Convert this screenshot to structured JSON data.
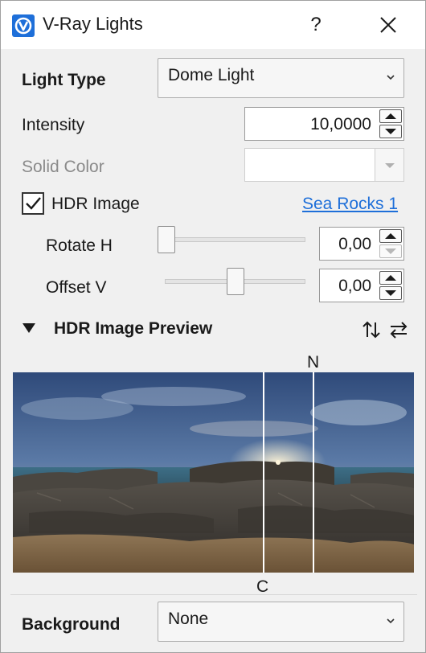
{
  "window": {
    "title": "V-Ray Lights",
    "help_label": "?",
    "close_icon": "close-icon",
    "app_icon": "vray-logo-icon"
  },
  "light_type": {
    "label": "Light Type",
    "value": "Dome Light"
  },
  "intensity": {
    "label": "Intensity",
    "value": "10,0000"
  },
  "solid_color": {
    "label": "Solid Color",
    "enabled": false
  },
  "hdr_image": {
    "label": "HDR Image",
    "checked": true,
    "file_link": "Sea Rocks 1"
  },
  "rotate_h": {
    "label": "Rotate H",
    "value": "0,00",
    "slider_fraction": 0.0
  },
  "offset_v": {
    "label": "Offset V",
    "value": "0,00",
    "slider_fraction": 0.5
  },
  "preview": {
    "section_title": "HDR Image Preview",
    "north_label": "N",
    "center_label": "C",
    "flip_vertical_icon": "flip-vertical-icon",
    "flip_horizontal_icon": "flip-horizontal-icon"
  },
  "background": {
    "label": "Background",
    "value": "None"
  },
  "colors": {
    "accent": "#1e6fd9",
    "link": "#1e6fd9",
    "panel_bg": "#f0f0f0",
    "disabled_text": "#8a8a8a"
  }
}
